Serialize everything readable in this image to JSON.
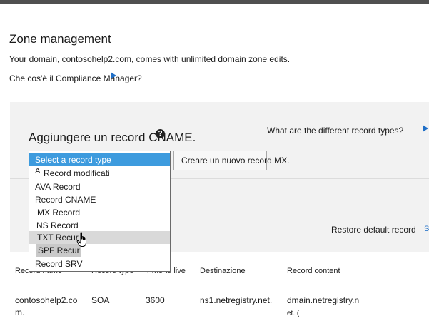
{
  "header": {
    "title": "Zone management",
    "description": "Your domain, contosohelp2.com, comes with unlimited domain zone edits.",
    "compliance_link": "Che cos'è il Compliance Manager?"
  },
  "panel": {
    "heading": "Aggiungere un record CNAME.",
    "help_glyph": "?",
    "record_types_link": "What are the different record types?",
    "new_record_button": "Creare un nuovo record MX.",
    "restore_link": "Restore default record",
    "restore_more": "S"
  },
  "record_type_dropdown": {
    "options": [
      "Select a record type",
      "A",
      "Record modificati",
      "AVA Record",
      "Record CNAME",
      "MX Record",
      "NS Record",
      "TXT Recur",
      "SPF Recur",
      "Record SRV"
    ],
    "selected": "Select a record type",
    "hovered": "TXT Recur"
  },
  "table": {
    "columns": [
      "Record name",
      "Record type",
      "Time to live",
      "Destinazione",
      "Record content"
    ],
    "rows": [
      {
        "name_line1": "contosohelp2.co",
        "name_line2": "m.",
        "type": "SOA",
        "ttl": "3600",
        "destination": "ns1.netregistry.net.",
        "content_line1": "dmain.netregistry.n",
        "content_line2": "et. ("
      }
    ]
  },
  "icons": [
    "help-icon",
    "arrow-right-icon",
    "hand-pointer-icon"
  ],
  "colors": {
    "accent": "#1f6fc7",
    "selection": "#3d9bde",
    "panel": "#f2f2f2"
  }
}
